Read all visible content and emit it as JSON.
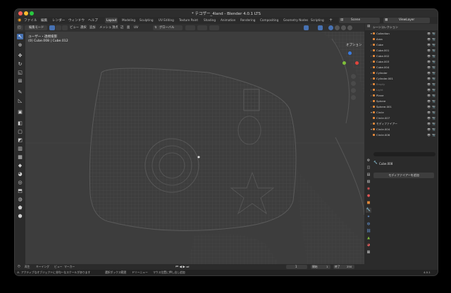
{
  "window": {
    "title": "* テコザー_4land - Blender 4.0.1 LTS"
  },
  "menubar": {
    "items": [
      "ファイル",
      "編集",
      "レンダー",
      "ウィンドウ",
      "ヘルプ"
    ],
    "workspaces": [
      "Layout",
      "Modeling",
      "Sculpting",
      "UV Editing",
      "Texture Paint",
      "Shading",
      "Animation",
      "Rendering",
      "Compositing",
      "Geometry Nodes",
      "Scripting"
    ],
    "active_workspace": "Layout",
    "scene": "Scene",
    "viewlayer": "ViewLayer"
  },
  "view_header": {
    "mode": "編集モード",
    "menus": [
      "ビュー",
      "選択",
      "追加",
      "メッシュ",
      "頂点",
      "辺",
      "面",
      "UV"
    ],
    "transform": "グローバル",
    "options": "オプション"
  },
  "viewport": {
    "overlay_line1": "ユーザー・透視投影",
    "overlay_line2": "(0) Cube.008 | Cube.012"
  },
  "outliner": {
    "header": "シーンコレクション",
    "rows": [
      {
        "name": "Collection",
        "tri": "▾",
        "dim": false
      },
      {
        "name": "Area",
        "tri": "",
        "dim": false
      },
      {
        "name": "Cube",
        "tri": "›",
        "dim": false
      },
      {
        "name": "Cube.001",
        "tri": "›",
        "dim": false
      },
      {
        "name": "Cube.002",
        "tri": "›",
        "dim": false
      },
      {
        "name": "Cube.003",
        "tri": "›",
        "dim": false
      },
      {
        "name": "Cube.004",
        "tri": "›",
        "dim": false
      },
      {
        "name": "Cylinder",
        "tri": "›",
        "dim": false
      },
      {
        "name": "Cylinder.001",
        "tri": "›",
        "dim": false
      },
      {
        "name": "Empty",
        "tri": "›",
        "dim": true
      },
      {
        "name": "Light",
        "tri": "›",
        "dim": true
      },
      {
        "name": "Plane",
        "tri": "›",
        "dim": false
      },
      {
        "name": "Sphere",
        "tri": "›",
        "dim": false
      },
      {
        "name": "Sphere.001",
        "tri": "›",
        "dim": false
      },
      {
        "name": "Circle",
        "tri": "▾",
        "dim": false
      },
      {
        "name": "Circle.007",
        "tri": "",
        "dim": false
      },
      {
        "name": "モディファイアー",
        "tri": "›",
        "dim": false
      },
      {
        "name": "Circle.004",
        "tri": "▾",
        "dim": false
      },
      {
        "name": "Circle.006",
        "tri": "",
        "dim": false
      }
    ]
  },
  "properties": {
    "object_name": "Cube.008",
    "add_modifier": "モディファイアーを追加"
  },
  "timeline": {
    "items": [
      "再生",
      "キーイング",
      "ビュー",
      "マーカー"
    ],
    "current_frame": "1",
    "start_label": "開始",
    "start": "1",
    "end_label": "終了",
    "end": "250"
  },
  "status": {
    "items": [
      "アクティブなオブジェクトに非均一なスケールがあります",
      "選択ボックス範囲",
      "ドリーニュー",
      "マウス位置に押し出し追加"
    ],
    "version": "4.0.1"
  },
  "colors": {
    "accent": "#4772b3",
    "viewport": "#3d3d3d",
    "panel": "#2a2a2a"
  }
}
